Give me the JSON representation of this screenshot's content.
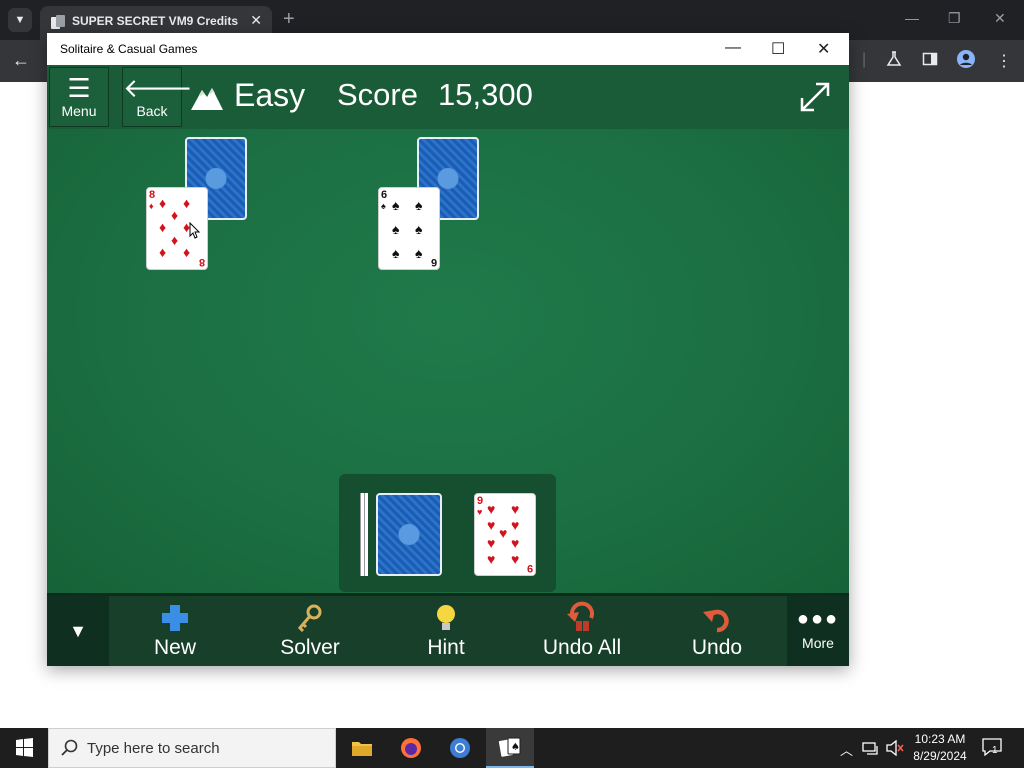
{
  "browser": {
    "tab_title": "SUPER SECRET VM9 Credits",
    "tab_close": "✕",
    "new_tab": "+",
    "minimize": "—",
    "restore": "❐",
    "close": "✕",
    "back": "←"
  },
  "window": {
    "title": "Solitaire & Casual Games",
    "minimize": "—",
    "maximize": "☐",
    "close": "✕"
  },
  "header": {
    "menu_label": "Menu",
    "back_label": "Back",
    "difficulty": "Easy",
    "score_label": "Score",
    "score_value": "15,300"
  },
  "cards": {
    "left_face": {
      "rank": "8",
      "suit": "♦",
      "color": "red"
    },
    "middle_face": {
      "rank": "6",
      "suit": "♠",
      "color": "black"
    },
    "waste_face": {
      "rank": "9",
      "suit": "♥",
      "color": "red"
    }
  },
  "toolbar": {
    "new_label": "New",
    "solver_label": "Solver",
    "hint_label": "Hint",
    "undo_all_label": "Undo All",
    "undo_label": "Undo",
    "more_label": "More"
  },
  "taskbar": {
    "search_placeholder": "Type here to search",
    "time": "10:23 AM",
    "date": "8/29/2024",
    "notification_count": "1"
  },
  "icons": {
    "menu": "hamburger-icon",
    "back": "arrow-left-icon",
    "difficulty": "mountain-icon",
    "expand": "expand-icon",
    "new": "plus-icon",
    "solver": "key-icon",
    "hint": "lightbulb-icon",
    "undo_all": "undo-all-icon",
    "undo": "undo-icon",
    "more": "more-dots-icon"
  },
  "colors": {
    "felt": "#1b6e42",
    "header": "#1a5b38",
    "toolbar": "#173f2a",
    "card_red": "#d0141e",
    "card_back": "#2466c2"
  }
}
